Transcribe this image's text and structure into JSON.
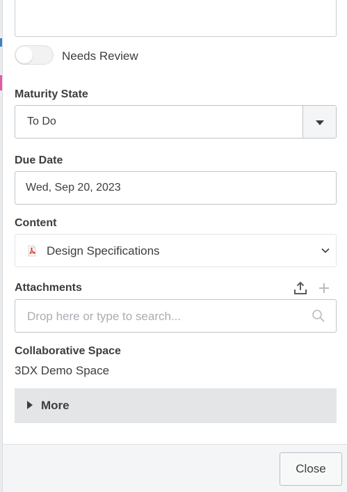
{
  "needs_review": {
    "label": "Needs Review",
    "enabled": false
  },
  "maturity_state": {
    "label": "Maturity State",
    "value": "To Do"
  },
  "due_date": {
    "label": "Due Date",
    "value": "Wed, Sep 20, 2023"
  },
  "content": {
    "label": "Content",
    "value": "Design Specifications",
    "icon": "pdf-file-icon"
  },
  "attachments": {
    "label": "Attachments",
    "placeholder": "Drop here or type to search...",
    "upload_icon": "upload-icon",
    "add_icon": "plus-icon"
  },
  "collaborative_space": {
    "label": "Collaborative Space",
    "value": "3DX Demo Space"
  },
  "more": {
    "label": "More"
  },
  "footer": {
    "close_label": "Close"
  },
  "colors": {
    "text": "#3d3d3d",
    "border": "#bfc4c8",
    "more_bg": "#e3e5e6",
    "pdf_red": "#d9372b"
  }
}
